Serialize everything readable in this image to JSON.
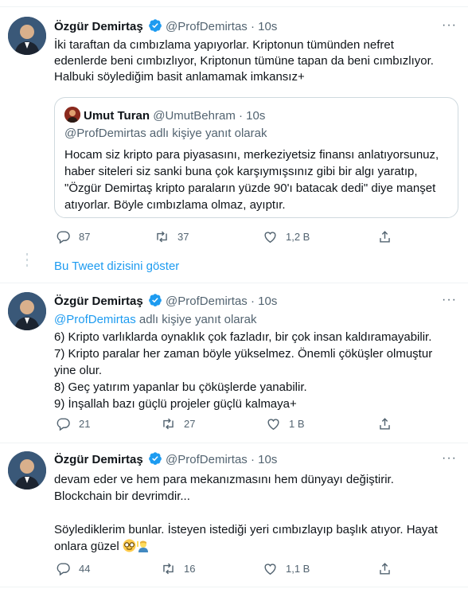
{
  "colors": {
    "accent": "#1d9bf0",
    "muted": "#536471",
    "border": "#cfd9de",
    "verified": "#1d9bf0"
  },
  "icons": [
    "verified-badge-icon",
    "more-dots-icon",
    "reply-icon",
    "retweet-icon",
    "like-icon",
    "share-icon"
  ],
  "tweets": [
    {
      "name": "Özgür Demirtaş",
      "handle": "@ProfDemirtas",
      "dot": "·",
      "time": "10s",
      "more": "···",
      "text": "İki taraftan da cımbızlama yapıyorlar. Kriptonun tümünden nefret\nedenlerde beni cımbızlıyor, Kriptonun tümüne tapan da beni cımbızlıyor.\nHalbuki söylediğim basit anlamamak imkansız+",
      "quote": {
        "name": "Umut Turan",
        "handle": "@UmutBehram",
        "dot": "·",
        "time": "10s",
        "reply_to": "@ProfDemirtas adlı kişiye yanıt olarak",
        "text": "Hocam siz kripto para piyasasını, merkeziyetsiz finansı anlatıyorsunuz,\nhaber siteleri siz sanki buna çok karşıymışsınız gibi bir algı yaratıp,\n\"Özgür Demirtaş kripto paraların yüzde 90'ı batacak dedi\" diye manşet\natıyorlar. Böyle cımbızlama olmaz, ayıptır."
      },
      "stats": {
        "replies": "87",
        "retweets": "37",
        "likes": "1,2 B"
      }
    },
    {
      "name": "Özgür Demirtaş",
      "handle": "@ProfDemirtas",
      "dot": "·",
      "time": "10s",
      "more": "···",
      "reply_mention": "@ProfDemirtas",
      "reply_suffix": " adlı kişiye yanıt olarak",
      "text": "6) Kripto varlıklarda oynaklık çok fazladır, bir çok insan kaldıramayabilir.\n7) Kripto paralar her zaman böyle yükselmez. Önemli çöküşler olmuştur\nyine olur.\n8) Geç yatırım yapanlar bu çöküşlerde yanabilir.\n9) İnşallah bazı güçlü projeler güçlü kalmaya+",
      "stats": {
        "replies": "21",
        "retweets": "27",
        "likes": "1 B"
      }
    },
    {
      "name": "Özgür Demirtaş",
      "handle": "@ProfDemirtas",
      "dot": "·",
      "time": "10s",
      "more": "···",
      "text": "devam eder ve hem para mekanızmasını hem dünyayı değiştirir.\nBlockchain bir devrimdir...\n\nSöylediklerim bunlar. İsteyen istediği yeri cımbızlayıp başlık atıyor. Hayat\nonlara güzel",
      "emojis": [
        "nerd-face-emoji",
        "person-raising-hand-emoji"
      ],
      "stats": {
        "replies": "44",
        "retweets": "16",
        "likes": "1,1 B"
      }
    }
  ],
  "show_thread": "Bu Tweet dizisini göster"
}
